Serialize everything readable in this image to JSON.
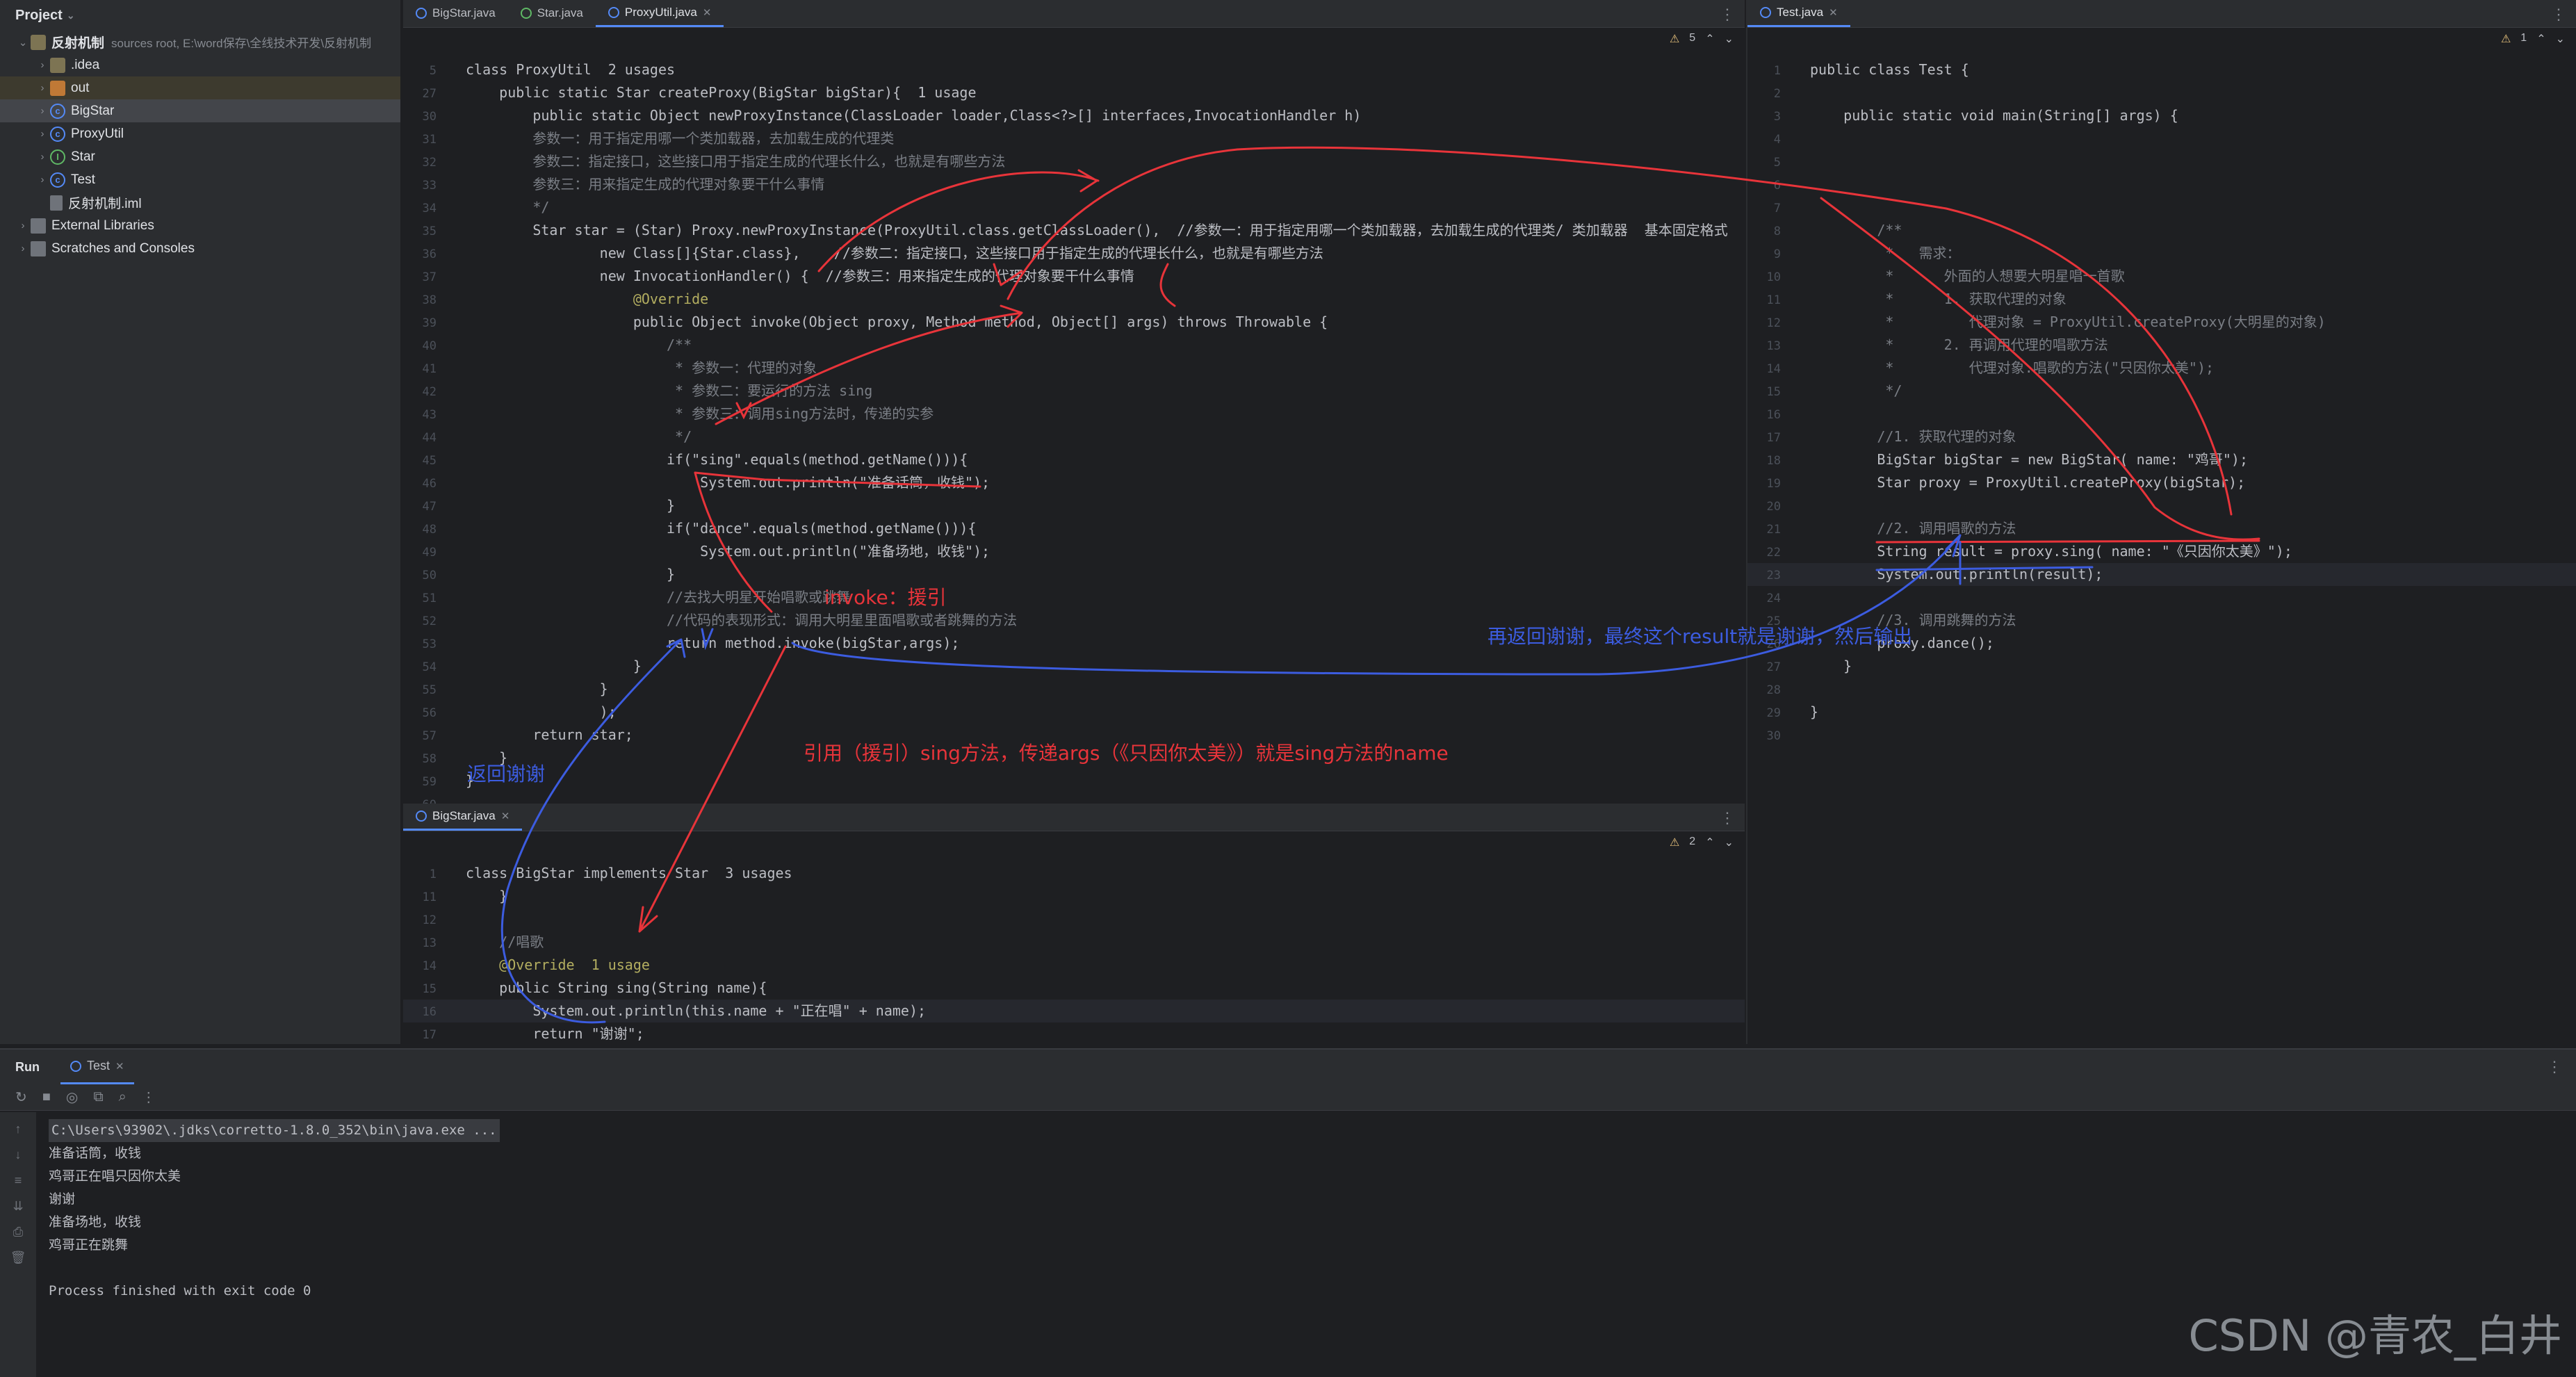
{
  "project": {
    "title": "Project",
    "root_name": "反射机制",
    "root_hint": "sources root, E:\\word保存\\全线技术开发\\反射机制",
    "items": [
      ".idea",
      "out",
      "BigStar",
      "ProxyUtil",
      "Star",
      "Test",
      "反射机制.iml"
    ],
    "external": "External Libraries",
    "scratches": "Scratches and Consoles"
  },
  "tabs_left": [
    "BigStar.java",
    "Star.java",
    "ProxyUtil.java"
  ],
  "tab_right": "Test.java",
  "tab_bottom": "BigStar.java",
  "proxy_warn": "5",
  "test_warn": "1",
  "bigstar_warn": "2",
  "proxy_code": [
    {
      "n": "5",
      "t": "class ProxyUtil  2 usages"
    },
    {
      "n": "27",
      "t": "    public static Star createProxy(BigStar bigStar){  1 usage"
    },
    {
      "n": "30",
      "t": "        public static Object newProxyInstance(ClassLoader loader,Class<?>[] interfaces,InvocationHandler h)"
    },
    {
      "n": "31",
      "t": "        参数一：用于指定用哪一个类加载器，去加载生成的代理类"
    },
    {
      "n": "32",
      "t": "        参数二：指定接口，这些接口用于指定生成的代理长什么，也就是有哪些方法"
    },
    {
      "n": "33",
      "t": "        参数三：用来指定生成的代理对象要干什么事情"
    },
    {
      "n": "34",
      "t": "        */"
    },
    {
      "n": "35",
      "t": "        Star star = (Star) Proxy.newProxyInstance(ProxyUtil.class.getClassLoader(),  //参数一：用于指定用哪一个类加载器，去加载生成的代理类/ 类加载器  基本固定格式"
    },
    {
      "n": "36",
      "t": "                new Class[]{Star.class},    //参数二：指定接口，这些接口用于指定生成的代理长什么，也就是有哪些方法"
    },
    {
      "n": "37",
      "t": "                new InvocationHandler() {  //参数三：用来指定生成的代理对象要干什么事情"
    },
    {
      "n": "38",
      "t": "                    @Override"
    },
    {
      "n": "39",
      "t": "                    public Object invoke(Object proxy, Method method, Object[] args) throws Throwable {"
    },
    {
      "n": "40",
      "t": "                        /**"
    },
    {
      "n": "41",
      "t": "                         * 参数一：代理的对象"
    },
    {
      "n": "42",
      "t": "                         * 参数二：要运行的方法 sing"
    },
    {
      "n": "43",
      "t": "                         * 参数三：调用sing方法时，传递的实参"
    },
    {
      "n": "44",
      "t": "                         */"
    },
    {
      "n": "45",
      "t": "                        if(\"sing\".equals(method.getName())){"
    },
    {
      "n": "46",
      "t": "                            System.out.println(\"准备话筒，收钱\");"
    },
    {
      "n": "47",
      "t": "                        }"
    },
    {
      "n": "48",
      "t": "                        if(\"dance\".equals(method.getName())){"
    },
    {
      "n": "49",
      "t": "                            System.out.println(\"准备场地，收钱\");"
    },
    {
      "n": "50",
      "t": "                        }"
    },
    {
      "n": "51",
      "t": "                        //去找大明星开始唱歌或跳舞"
    },
    {
      "n": "52",
      "t": "                        //代码的表现形式：调用大明星里面唱歌或者跳舞的方法"
    },
    {
      "n": "53",
      "t": "                        return method.invoke(bigStar,args);"
    },
    {
      "n": "54",
      "t": "                    }"
    },
    {
      "n": "55",
      "t": "                }"
    },
    {
      "n": "56",
      "t": "                );"
    },
    {
      "n": "57",
      "t": "        return star;"
    },
    {
      "n": "58",
      "t": "    }"
    },
    {
      "n": "59",
      "t": "}"
    },
    {
      "n": "60",
      "t": ""
    }
  ],
  "bigstar_code": [
    {
      "n": "1",
      "t": "class BigStar implements Star  3 usages"
    },
    {
      "n": "11",
      "t": "    }"
    },
    {
      "n": "12",
      "t": ""
    },
    {
      "n": "13",
      "t": "    //唱歌"
    },
    {
      "n": "14",
      "t": "    @Override  1 usage"
    },
    {
      "n": "15",
      "t": "    public String sing(String name){"
    },
    {
      "n": "16",
      "t": "        System.out.println(this.name + \"正在唱\" + name);"
    },
    {
      "n": "17",
      "t": "        return \"谢谢\";"
    },
    {
      "n": "18",
      "t": "    }"
    }
  ],
  "test_code": [
    {
      "n": "1",
      "t": "public class Test {"
    },
    {
      "n": "2",
      "t": ""
    },
    {
      "n": "3",
      "t": "    public static void main(String[] args) {"
    },
    {
      "n": "4",
      "t": ""
    },
    {
      "n": "5",
      "t": ""
    },
    {
      "n": "6",
      "t": ""
    },
    {
      "n": "7",
      "t": ""
    },
    {
      "n": "8",
      "t": "        /**"
    },
    {
      "n": "9",
      "t": "         *   需求："
    },
    {
      "n": "10",
      "t": "         *      外面的人想要大明星唱一首歌"
    },
    {
      "n": "11",
      "t": "         *      1. 获取代理的对象"
    },
    {
      "n": "12",
      "t": "         *         代理对象 = ProxyUtil.createProxy(大明星的对象)"
    },
    {
      "n": "13",
      "t": "         *      2. 再调用代理的唱歌方法"
    },
    {
      "n": "14",
      "t": "         *         代理对象.唱歌的方法(\"只因你太美\");"
    },
    {
      "n": "15",
      "t": "         */"
    },
    {
      "n": "16",
      "t": ""
    },
    {
      "n": "17",
      "t": "        //1. 获取代理的对象"
    },
    {
      "n": "18",
      "t": "        BigStar bigStar = new BigStar( name: \"鸡哥\");"
    },
    {
      "n": "19",
      "t": "        Star proxy = ProxyUtil.createProxy(bigStar);"
    },
    {
      "n": "20",
      "t": ""
    },
    {
      "n": "21",
      "t": "        //2. 调用唱歌的方法"
    },
    {
      "n": "22",
      "t": "        String result = proxy.sing( name: \"《只因你太美》\");"
    },
    {
      "n": "23",
      "t": "        System.out.println(result);"
    },
    {
      "n": "24",
      "t": ""
    },
    {
      "n": "25",
      "t": "        //3. 调用跳舞的方法"
    },
    {
      "n": "26",
      "t": "        proxy.dance();"
    },
    {
      "n": "27",
      "t": "    }"
    },
    {
      "n": "28",
      "t": ""
    },
    {
      "n": "29",
      "t": "}"
    },
    {
      "n": "30",
      "t": ""
    }
  ],
  "run": {
    "title": "Run",
    "tab": "Test",
    "output": [
      "C:\\Users\\93902\\.jdks\\corretto-1.8.0_352\\bin\\java.exe ...",
      "准备话筒，收钱",
      "鸡哥正在唱只因你太美",
      "谢谢",
      "准备场地，收钱",
      "鸡哥正在跳舞",
      "",
      "Process finished with exit code 0"
    ]
  },
  "annotations": {
    "invoke": "invoke：援引",
    "return_thanks": "返回谢谢",
    "call_sing": "引用（援引）sing方法，传递args（《只因你太美》）就是sing方法的name",
    "return_result": "再返回谢谢，最终这个result就是谢谢，然后输出"
  },
  "watermark": "CSDN @青农_白井",
  "colors": {
    "annotation_red": "#e8343a",
    "annotation_blue": "#3c5ce0",
    "accent": "#548af7"
  }
}
